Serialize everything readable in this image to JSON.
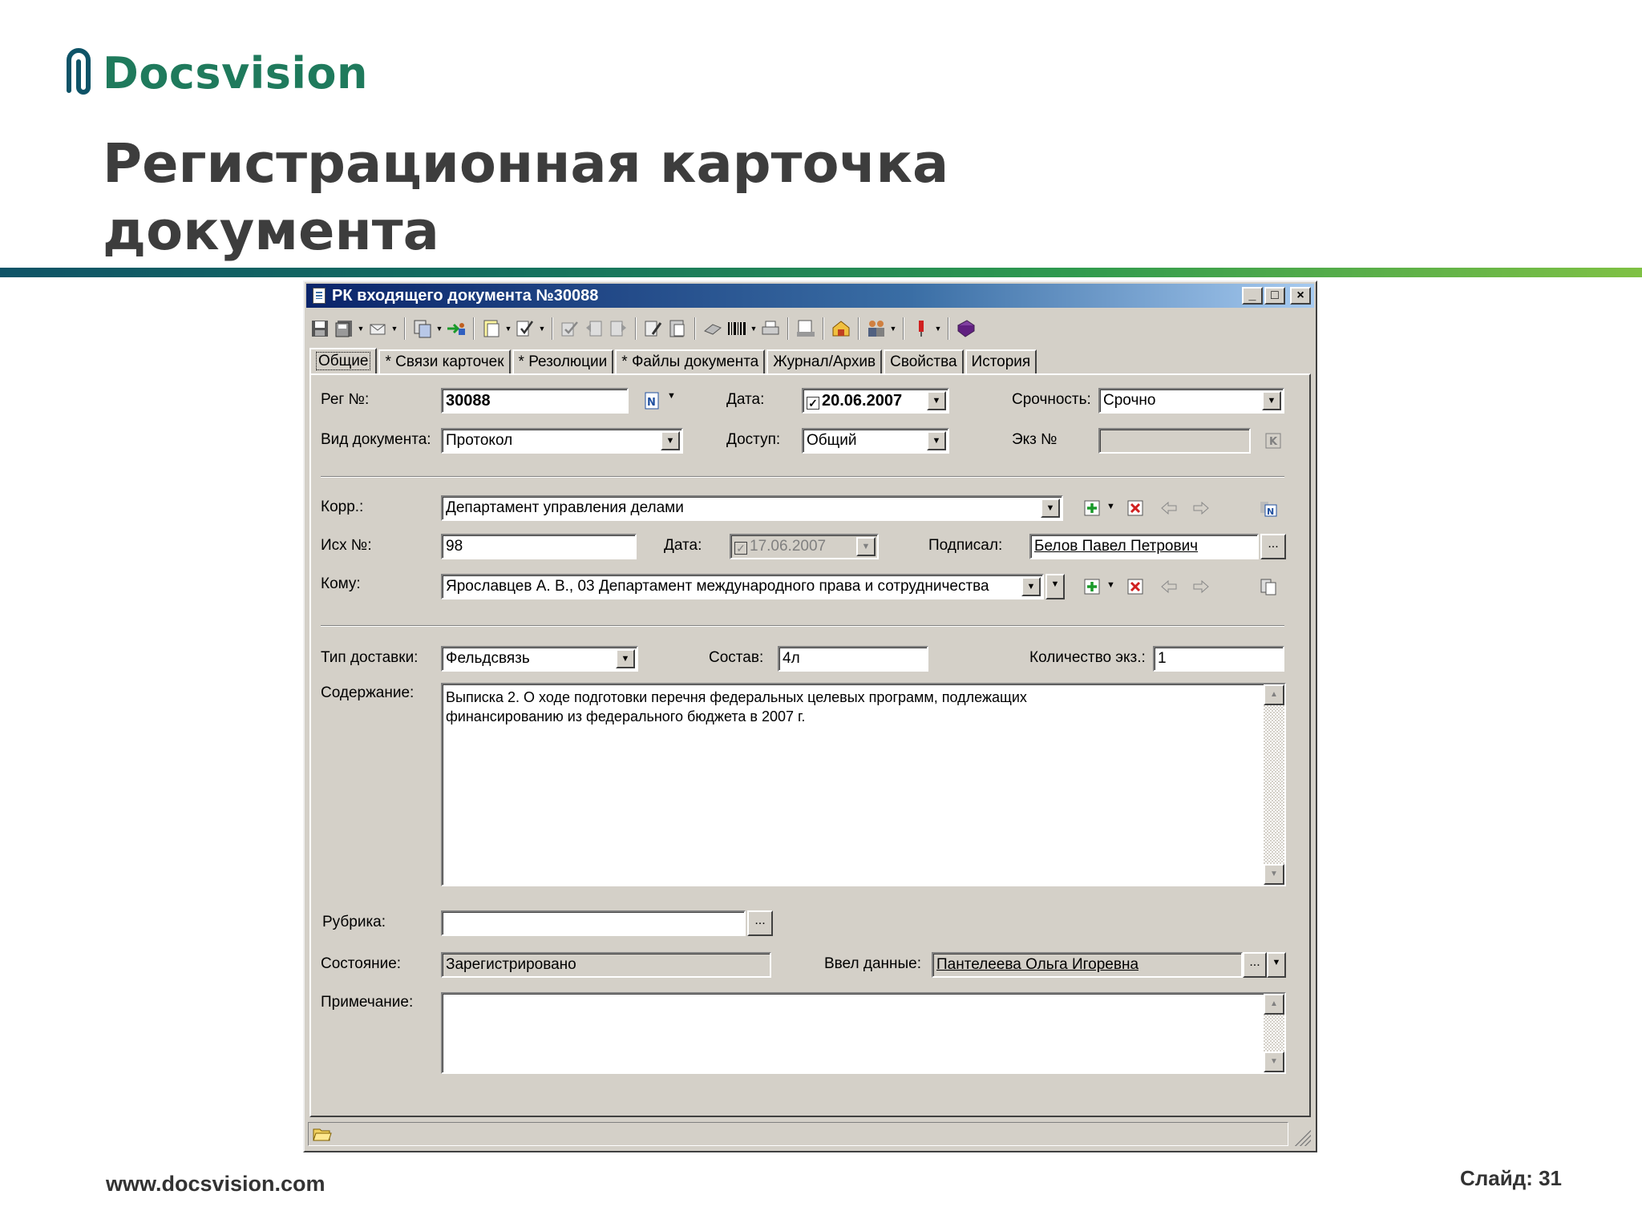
{
  "slide": {
    "logo_text": "Docsvision",
    "title_line1": "Регистрационная карточка",
    "title_line2": "документа",
    "footer_url": "www.docsvision.com",
    "slide_number": "Слайд: 31",
    "accent_color": "#1f7a5c"
  },
  "window": {
    "title": "РК входящего документа №30088",
    "min_label": "_",
    "max_label": "□",
    "close_label": "×"
  },
  "toolbar": {
    "icons": [
      "save-icon",
      "save-options-icon",
      "send-mail-icon",
      "copy-card-icon",
      "forward-icon",
      "new-document-icon",
      "check-icon",
      "approve-icon",
      "undo-icon",
      "redo-icon",
      "edit-icon",
      "paste-icon",
      "print-preview-icon",
      "barcode-icon",
      "printer-icon",
      "print-card-icon",
      "archive-icon",
      "users-icon",
      "marker-icon",
      "book-icon"
    ]
  },
  "tabs": [
    {
      "label": "Общие",
      "active": true
    },
    {
      "label": "* Связи карточек"
    },
    {
      "label": "* Резолюции"
    },
    {
      "label": "* Файлы документа"
    },
    {
      "label": "Журнал/Архив"
    },
    {
      "label": "Свойства"
    },
    {
      "label": "История"
    }
  ],
  "form": {
    "reg_no_label": "Рег №:",
    "reg_no_value": "30088",
    "date_label": "Дата:",
    "date_value": "20.06.2007",
    "urgency_label": "Срочность:",
    "urgency_value": "Срочно",
    "doc_type_label": "Вид документа:",
    "doc_type_value": "Протокол",
    "access_label": "Доступ:",
    "access_value": "Общий",
    "copy_no_label": "Экз №",
    "copy_no_value": "",
    "corr_label": "Корр.:",
    "corr_value": "Департамент управления делами",
    "out_no_label": "Исх №:",
    "out_no_value": "98",
    "out_date_label": "Дата:",
    "out_date_value": "17.06.2007",
    "signed_label": "Подписал:",
    "signed_value": "Белов Павел Петрович",
    "to_label": "Кому:",
    "to_value": "Ярославцев А. В., 03 Департамент международного права и сотрудничества",
    "delivery_label": "Тип доставки:",
    "delivery_value": "Фельдсвязь",
    "composition_label": "Состав:",
    "composition_value": "4л",
    "copies_label": "Количество экз.:",
    "copies_value": "1",
    "content_label": "Содержание:",
    "content_line1": "Выписка 2. О ходе подготовки перечня федеральных целевых программ, подлежащих",
    "content_line2": "финансированию из федерального бюджета в 2007 г.",
    "rubric_label": "Рубрика:",
    "rubric_value": "",
    "state_label": "Состояние:",
    "state_value": "Зарегистрировано",
    "entered_label": "Ввел данные:",
    "entered_value": "Пантелеева Ольга Игоревна",
    "note_label": "Примечание:",
    "note_value": "",
    "ellipsis": "..."
  }
}
